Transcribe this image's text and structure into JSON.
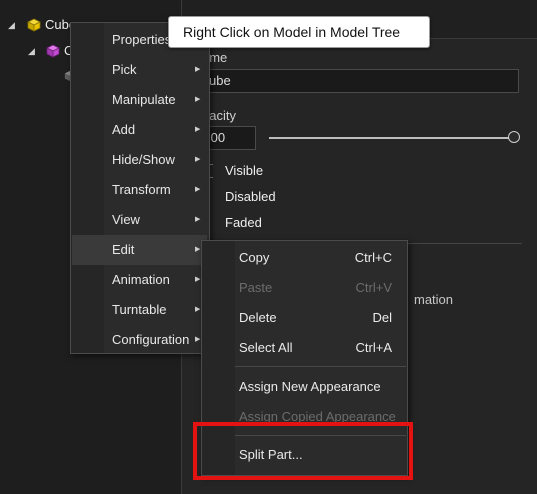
{
  "tree": {
    "root_label": "Cube",
    "child_label": "C"
  },
  "panel": {
    "name_label": "ame",
    "name_value": "ube",
    "opacity_label": "pacity",
    "opacity_value": ".00",
    "opacity_slider_level": 1.0,
    "state_items": [
      "Visible",
      "Disabled",
      "Faded"
    ],
    "animation_partial": "mation"
  },
  "tooltip": {
    "text": "Right Click on Model in Model Tree"
  },
  "context_menu": {
    "items": [
      {
        "label": "Properties",
        "has_submenu": false
      },
      {
        "label": "Pick",
        "has_submenu": true
      },
      {
        "label": "Manipulate",
        "has_submenu": true
      },
      {
        "label": "Add",
        "has_submenu": true
      },
      {
        "label": "Hide/Show",
        "has_submenu": true
      },
      {
        "label": "Transform",
        "has_submenu": true
      },
      {
        "label": "View",
        "has_submenu": true
      },
      {
        "label": "Edit",
        "has_submenu": true
      },
      {
        "label": "Animation",
        "has_submenu": true
      },
      {
        "label": "Turntable",
        "has_submenu": true
      },
      {
        "label": "Configuration",
        "has_submenu": true
      }
    ],
    "highlighted": "Edit"
  },
  "edit_submenu": {
    "items": [
      {
        "label": "Copy",
        "shortcut": "Ctrl+C",
        "enabled": true
      },
      {
        "label": "Paste",
        "shortcut": "Ctrl+V",
        "enabled": false
      },
      {
        "label": "Delete",
        "shortcut": "Del",
        "enabled": true
      },
      {
        "label": "Select All",
        "shortcut": "Ctrl+A",
        "enabled": true
      },
      {
        "label": "Assign New Appearance",
        "shortcut": "",
        "enabled": true
      },
      {
        "label": "Assign Copied Appearance",
        "shortcut": "",
        "enabled": false
      },
      {
        "label": "Split Part...",
        "shortcut": "",
        "enabled": true
      }
    ]
  },
  "colors": {
    "annotation_red": "#e51212",
    "cube_root_icon": "#e6c200",
    "cube_child_icon": "#c04ad0"
  }
}
